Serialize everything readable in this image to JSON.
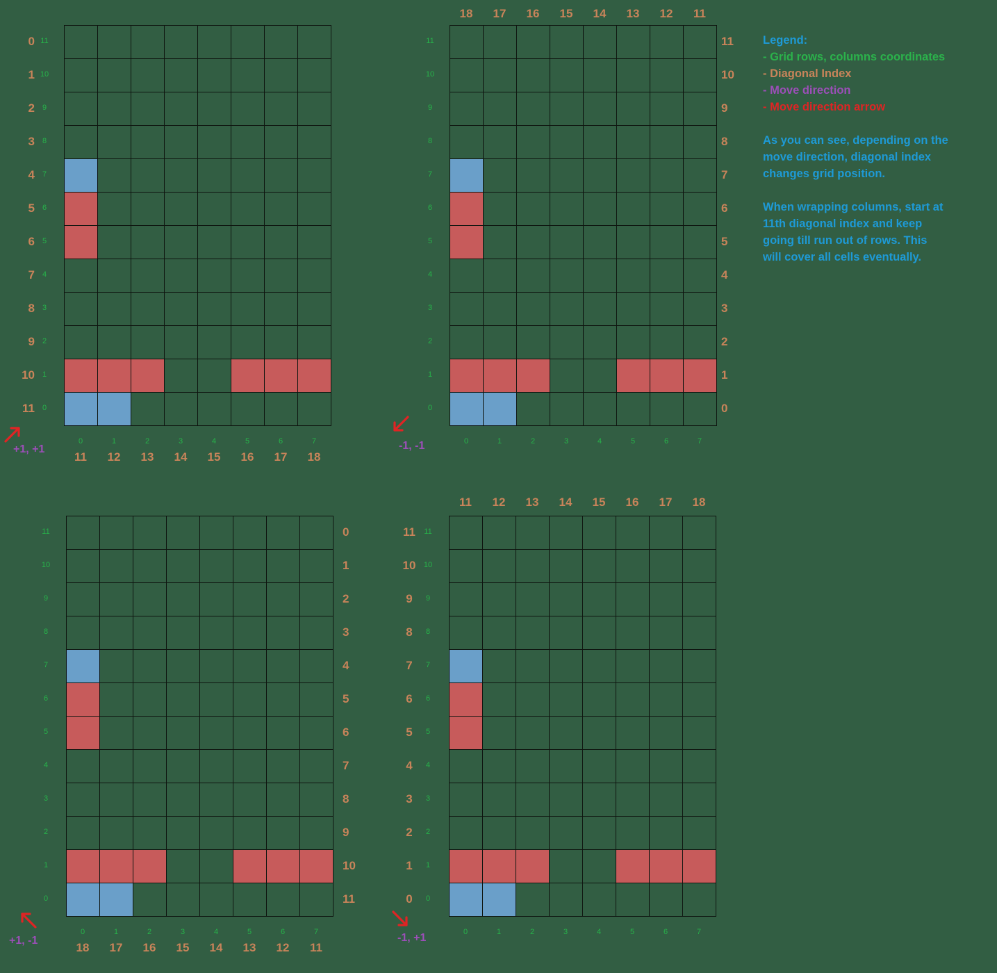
{
  "colors": {
    "background": "#325e43",
    "grid_line": "#0e140f",
    "red_cell": "#c75b5b",
    "blue_cell": "#6a9fc9",
    "diagonal_index": "#c8845a",
    "coordinate": "#27b34a",
    "move_direction": "#9c4fb8",
    "arrow": "#e02424",
    "note": "#1e9ad6"
  },
  "grid_spec": {
    "rows": 12,
    "cols": 8,
    "red_cells": [
      [
        5,
        0
      ],
      [
        6,
        0
      ],
      [
        10,
        0
      ],
      [
        10,
        1
      ],
      [
        10,
        2
      ],
      [
        10,
        5
      ],
      [
        10,
        6
      ],
      [
        10,
        7
      ]
    ],
    "blue_cells": [
      [
        4,
        0
      ],
      [
        11,
        0
      ],
      [
        11,
        1
      ]
    ],
    "row_coordinates": [
      "11",
      "10",
      "9",
      "8",
      "7",
      "6",
      "5",
      "4",
      "3",
      "2",
      "1",
      "0"
    ],
    "column_coordinates": [
      "0",
      "1",
      "2",
      "3",
      "4",
      "5",
      "6",
      "7"
    ]
  },
  "panels": [
    {
      "id": "top-left",
      "move_direction": "+1, +1",
      "arrow_icon": "arrow-up-right-icon",
      "diagonal_rows": [
        "0",
        "1",
        "2",
        "3",
        "4",
        "5",
        "6",
        "7",
        "8",
        "9",
        "10",
        "11"
      ],
      "diagonal_cols": [
        "11",
        "12",
        "13",
        "14",
        "15",
        "16",
        "17",
        "18"
      ]
    },
    {
      "id": "top-right",
      "move_direction": "-1, -1",
      "arrow_icon": "arrow-down-left-icon",
      "diagonal_rows": [
        "11",
        "10",
        "9",
        "8",
        "7",
        "6",
        "5",
        "4",
        "3",
        "2",
        "1",
        "0"
      ],
      "diagonal_cols": [
        "18",
        "17",
        "16",
        "15",
        "14",
        "13",
        "12",
        "11"
      ]
    },
    {
      "id": "bottom-left",
      "move_direction": "+1, -1",
      "arrow_icon": "arrow-up-left-icon",
      "diagonal_rows": [
        "0",
        "1",
        "2",
        "3",
        "4",
        "5",
        "6",
        "7",
        "8",
        "9",
        "10",
        "11"
      ],
      "diagonal_cols": [
        "18",
        "17",
        "16",
        "15",
        "14",
        "13",
        "12",
        "11"
      ]
    },
    {
      "id": "bottom-right",
      "move_direction": "-1, +1",
      "arrow_icon": "arrow-down-right-icon",
      "diagonal_rows": [
        "11",
        "10",
        "9",
        "8",
        "7",
        "6",
        "5",
        "4",
        "3",
        "2",
        "1",
        "0"
      ],
      "diagonal_cols": [
        "11",
        "12",
        "13",
        "14",
        "15",
        "16",
        "17",
        "18"
      ]
    }
  ],
  "legend": {
    "title": "Legend:",
    "items": [
      "- Grid rows, columns coordinates",
      "- Diagonal Index",
      "- Move direction",
      "- Move direction arrow"
    ],
    "paragraph1": [
      "As you can see, depending on the",
      "move direction, diagonal index",
      "changes grid position."
    ],
    "paragraph2": [
      "When wrapping columns, start at",
      "11th diagonal index and keep",
      "going till run out of rows. This",
      "will cover all cells eventually."
    ]
  }
}
